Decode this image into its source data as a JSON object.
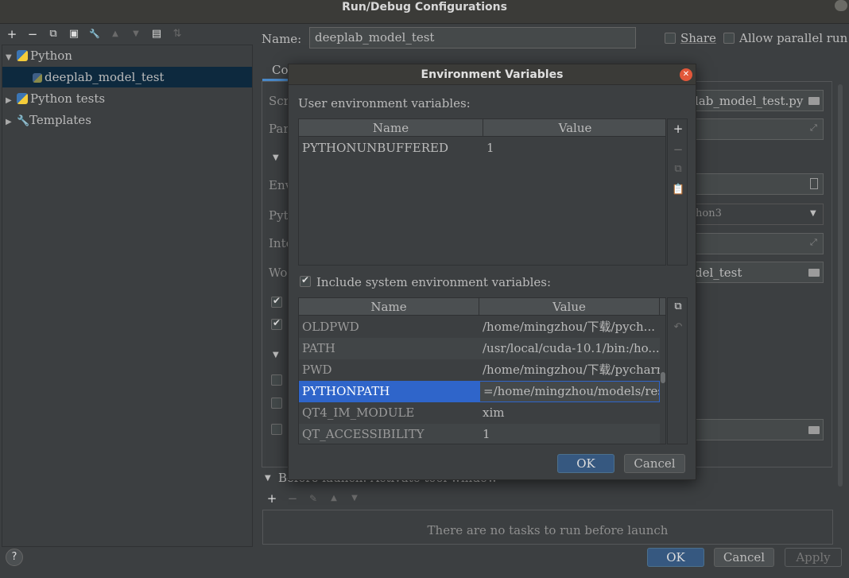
{
  "window": {
    "title": "Run/Debug Configurations"
  },
  "toolbar": {
    "icons": [
      "add-icon",
      "remove-icon",
      "copy-icon",
      "save-icon",
      "wrench-icon",
      "move-up-icon",
      "move-down-icon",
      "folder-add-icon",
      "sort-icon"
    ],
    "glyphs": {
      "add": "+",
      "remove": "−",
      "copy": "⧉",
      "save": "▣",
      "wrench": "🔧",
      "up": "▲",
      "down": "▼",
      "folder": "▤",
      "sort": "⇅"
    }
  },
  "tree": {
    "python": "Python",
    "config": "deeplab_model_test",
    "python_tests": "Python tests",
    "templates": "Templates"
  },
  "config": {
    "name_label": "Name:",
    "name_value": "deeplab_model_test",
    "share_label": "Share",
    "parallel_label": "Allow parallel run",
    "tab": "Co",
    "rows": {
      "script": "Scr",
      "params": "Par",
      "section": "",
      "env": "Env",
      "python": "Pyt",
      "interp": "Inte",
      "working": "Wo"
    },
    "script_value_tail": "lab_model_test.py",
    "python_value_tail": "hon3",
    "working_value_tail": "del_test",
    "before_launch": "Before launch: Activate tool window",
    "no_tasks": "There are no tasks to run before launch"
  },
  "footer": {
    "help": "?",
    "ok": "OK",
    "cancel": "Cancel",
    "apply": "Apply"
  },
  "dialog": {
    "title": "Environment Variables",
    "user_label": "User environment variables:",
    "include_label": "Include system environment variables:",
    "include_checked": true,
    "headers": {
      "name": "Name",
      "value": "Value"
    },
    "user_vars": [
      {
        "name": "PYTHONUNBUFFERED",
        "value": "1"
      }
    ],
    "system_vars": [
      {
        "name": "OLDPWD",
        "value": "/home/mingzhou/下载/pych..."
      },
      {
        "name": "PATH",
        "value": "/usr/local/cuda-10.1/bin:/ho..."
      },
      {
        "name": "PWD",
        "value": "/home/mingzhou/下载/pycharm"
      },
      {
        "name": "PYTHONPATH",
        "value": "=/home/mingzhou/models/res"
      },
      {
        "name": "QT4_IM_MODULE",
        "value": "xim"
      },
      {
        "name": "QT_ACCESSIBILITY",
        "value": "1"
      }
    ],
    "ok": "OK",
    "cancel": "Cancel",
    "selection_color": "#2f65ca"
  }
}
